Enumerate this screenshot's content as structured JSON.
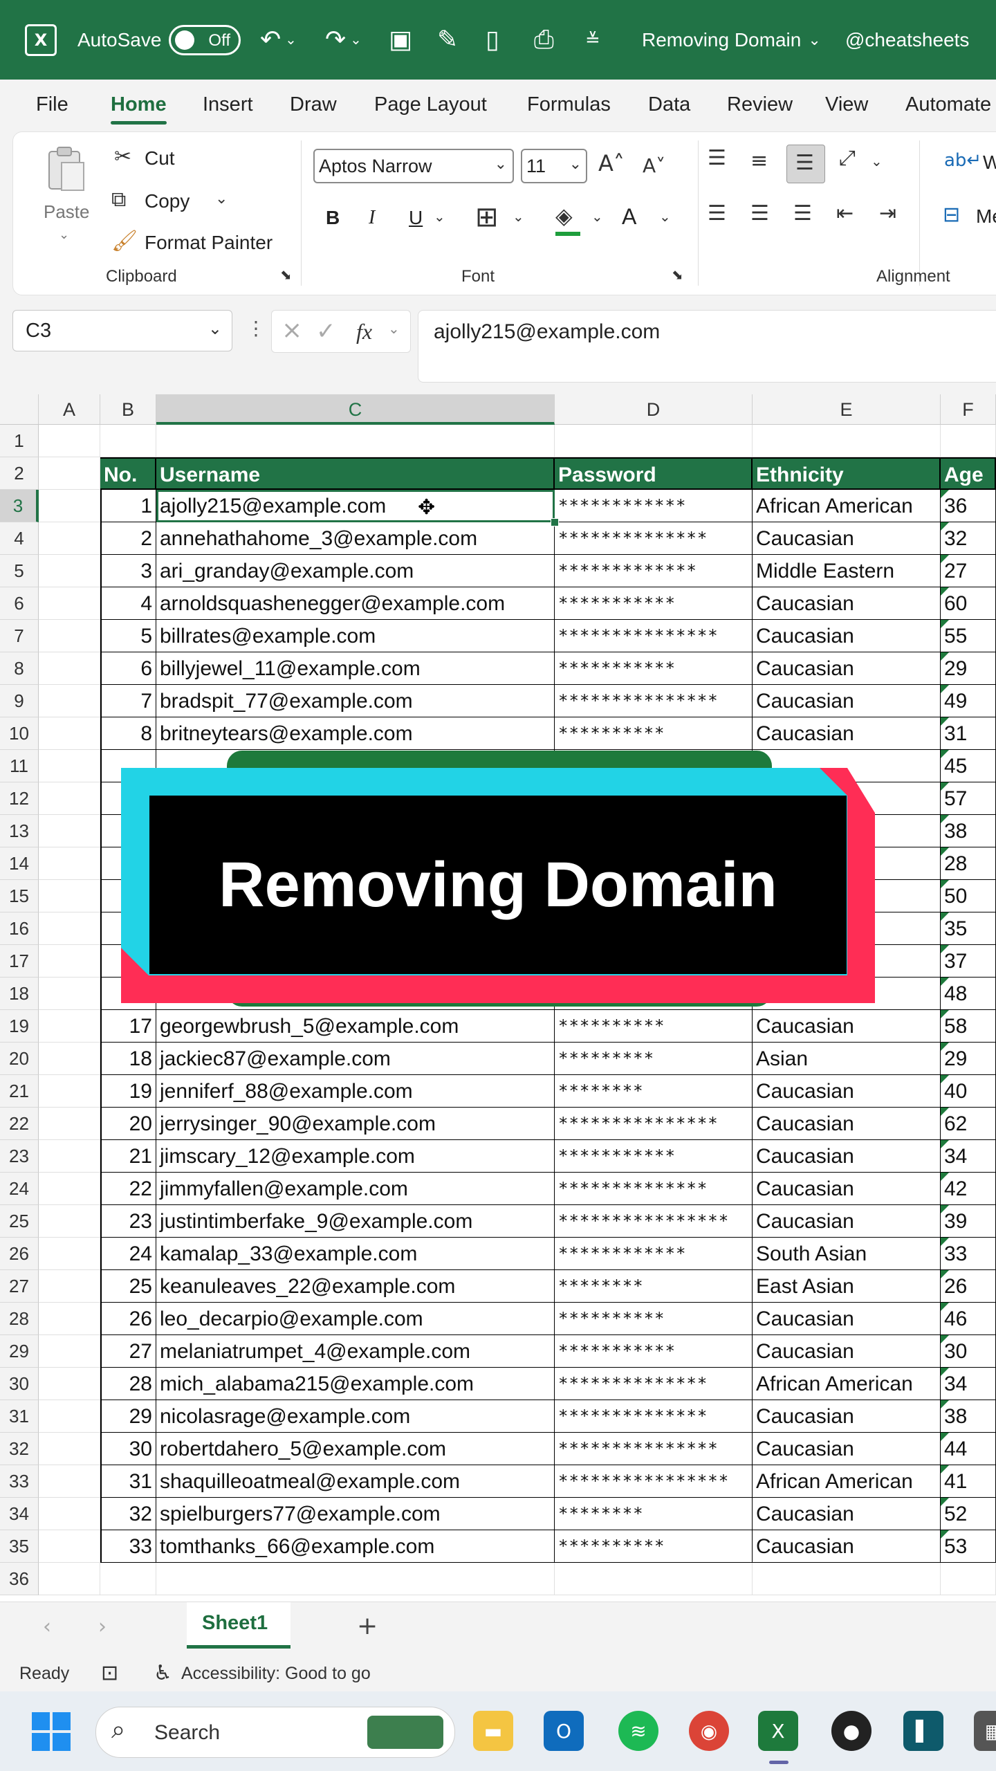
{
  "titlebar": {
    "autosave_label": "AutoSave",
    "autosave_state": "Off",
    "doc_title": "Removing Domain",
    "handle": "@cheatsheets"
  },
  "menu": [
    "File",
    "Home",
    "Insert",
    "Draw",
    "Page Layout",
    "Formulas",
    "Data",
    "Review",
    "View",
    "Automate"
  ],
  "menu_active": "Home",
  "ribbon": {
    "paste": "Paste",
    "cut": "Cut",
    "copy": "Copy",
    "format_painter": "Format Painter",
    "clipboard_group": "Clipboard",
    "font_name": "Aptos Narrow",
    "font_size": "11",
    "font_group": "Font",
    "alignment_group": "Alignment",
    "wrap_partial": "Wr",
    "merge_partial": "Me"
  },
  "formula_bar": {
    "name_box": "C3",
    "fx": "fx",
    "formula": "ajolly215@example.com"
  },
  "columns": [
    "A",
    "B",
    "C",
    "D",
    "E",
    "F"
  ],
  "headers": [
    "No.",
    "Username",
    "Password",
    "Ethnicity",
    "Age"
  ],
  "rows": [
    {
      "no": "1",
      "user": "ajolly215@example.com",
      "pw": "************",
      "eth": "African American",
      "age": "36"
    },
    {
      "no": "2",
      "user": "annehathahome_3@example.com",
      "pw": "**************",
      "eth": "Caucasian",
      "age": "32"
    },
    {
      "no": "3",
      "user": "ari_granday@example.com",
      "pw": "*************",
      "eth": "Middle Eastern",
      "age": "27"
    },
    {
      "no": "4",
      "user": "arnoldsquashenegger@example.com",
      "pw": "***********",
      "eth": "Caucasian",
      "age": "60"
    },
    {
      "no": "5",
      "user": "billrates@example.com",
      "pw": "***************",
      "eth": "Caucasian",
      "age": "55"
    },
    {
      "no": "6",
      "user": "billyjewel_11@example.com",
      "pw": "***********",
      "eth": "Caucasian",
      "age": "29"
    },
    {
      "no": "7",
      "user": "bradspit_77@example.com",
      "pw": "***************",
      "eth": "Caucasian",
      "age": "49"
    },
    {
      "no": "8",
      "user": "britneytears@example.com",
      "pw": "**********",
      "eth": "Caucasian",
      "age": "31"
    },
    {
      "no": "",
      "user": "",
      "pw": "",
      "eth": "",
      "age": "45"
    },
    {
      "no": "",
      "user": "",
      "pw": "",
      "eth": "",
      "age": "57"
    },
    {
      "no": "",
      "user": "",
      "pw": "",
      "eth": "",
      "age": "38"
    },
    {
      "no": "",
      "user": "",
      "pw": "",
      "eth": "",
      "age": "28"
    },
    {
      "no": "",
      "user": "",
      "pw": "",
      "eth": "erican",
      "age": "50"
    },
    {
      "no": "",
      "user": "",
      "pw": "",
      "eth": "",
      "age": "35"
    },
    {
      "no": "",
      "user": "",
      "pw": "",
      "eth": "erican",
      "age": "37"
    },
    {
      "no": "16",
      "user": "",
      "pw": "",
      "eth": "",
      "age": "48"
    },
    {
      "no": "17",
      "user": "georgewbrush_5@example.com",
      "pw": "**********",
      "eth": "Caucasian",
      "age": "58"
    },
    {
      "no": "18",
      "user": "jackiec87@example.com",
      "pw": "*********",
      "eth": "Asian",
      "age": "29"
    },
    {
      "no": "19",
      "user": "jenniferf_88@example.com",
      "pw": "********",
      "eth": "Caucasian",
      "age": "40"
    },
    {
      "no": "20",
      "user": "jerrysinger_90@example.com",
      "pw": "***************",
      "eth": "Caucasian",
      "age": "62"
    },
    {
      "no": "21",
      "user": "jimscary_12@example.com",
      "pw": "***********",
      "eth": "Caucasian",
      "age": "34"
    },
    {
      "no": "22",
      "user": "jimmyfallen@example.com",
      "pw": "**************",
      "eth": "Caucasian",
      "age": "42"
    },
    {
      "no": "23",
      "user": "justintimberfake_9@example.com",
      "pw": "****************",
      "eth": "Caucasian",
      "age": "39"
    },
    {
      "no": "24",
      "user": "kamalap_33@example.com",
      "pw": "************",
      "eth": "South Asian",
      "age": "33"
    },
    {
      "no": "25",
      "user": "keanuleaves_22@example.com",
      "pw": "********",
      "eth": "East Asian",
      "age": "26"
    },
    {
      "no": "26",
      "user": "leo_decarpio@example.com",
      "pw": "**********",
      "eth": "Caucasian",
      "age": "46"
    },
    {
      "no": "27",
      "user": "melaniatrumpet_4@example.com",
      "pw": "***********",
      "eth": "Caucasian",
      "age": "30"
    },
    {
      "no": "28",
      "user": "mich_alabama215@example.com",
      "pw": "**************",
      "eth": "African American",
      "age": "34"
    },
    {
      "no": "29",
      "user": "nicolasrage@example.com",
      "pw": "**************",
      "eth": "Caucasian",
      "age": "38"
    },
    {
      "no": "30",
      "user": "robertdahero_5@example.com",
      "pw": "***************",
      "eth": "Caucasian",
      "age": "44"
    },
    {
      "no": "31",
      "user": "shaquilleoatmeal@example.com",
      "pw": "****************",
      "eth": "African American",
      "age": "41"
    },
    {
      "no": "32",
      "user": "spielburgers77@example.com",
      "pw": "********",
      "eth": "Caucasian",
      "age": "52"
    },
    {
      "no": "33",
      "user": "tomthanks_66@example.com",
      "pw": "**********",
      "eth": "Caucasian",
      "age": "53"
    }
  ],
  "overlay_title": "Removing Domain",
  "sheet_tab": "Sheet1",
  "status": {
    "ready": "Ready",
    "accessibility": "Accessibility: Good to go"
  },
  "taskbar": {
    "search_placeholder": "Search"
  },
  "colors": {
    "excel_green": "#217346",
    "overlay_cyan": "#22d3e6",
    "overlay_red": "#ff2d55"
  }
}
